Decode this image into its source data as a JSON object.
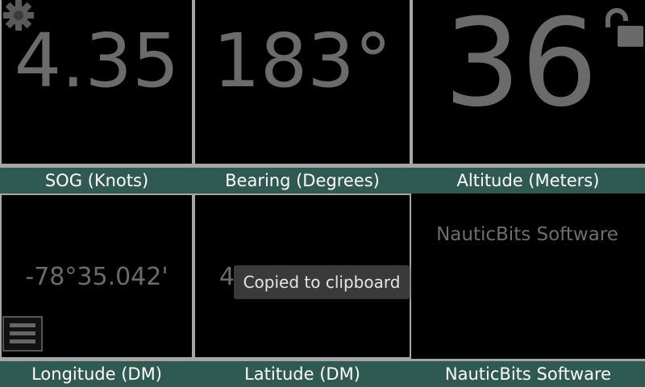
{
  "tiles": [
    {
      "value": "4.35",
      "label": "SOG (Knots)"
    },
    {
      "value": "183°",
      "label": "Bearing (Degrees)"
    },
    {
      "value": "36",
      "label": "Altitude (Meters)"
    },
    {
      "value": "-78°35.042'",
      "label": "Longitude (DM)"
    },
    {
      "value": "4",
      "label": "Latitude (DM)"
    },
    {
      "value": "NauticBits Software",
      "label": "NauticBits Software"
    }
  ],
  "toast": {
    "text": "Copied to clipboard"
  },
  "icons": {
    "settings": "gear-icon",
    "unlock": "unlock-icon",
    "menu": "menu-icon"
  }
}
